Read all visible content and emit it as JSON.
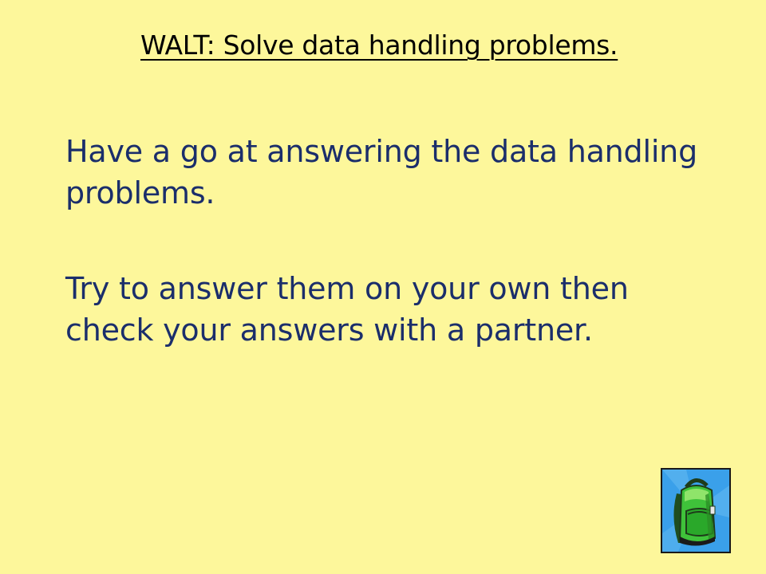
{
  "colors": {
    "background": "#fdf79b",
    "body_text": "#1b2e6b",
    "title_text": "#000000",
    "clipart_bg": "#3aa0ea"
  },
  "slide": {
    "title": "WALT: Solve data handling problems.",
    "paragraphs": [
      "Have a go at answering the data handling problems.",
      "Try to answer them on your own then check your answers with a partner."
    ],
    "clipart_icon": "backpack-icon"
  }
}
